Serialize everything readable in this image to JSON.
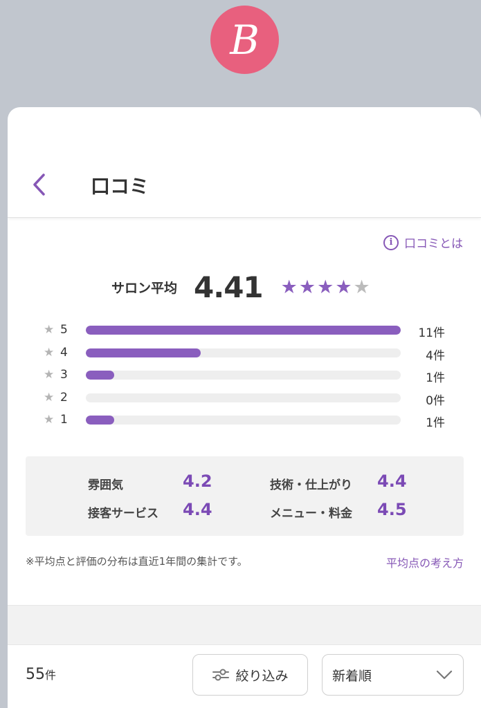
{
  "logo": {
    "letter": "B",
    "color": "#e8607e"
  },
  "header": {
    "title": "口コミ",
    "back_icon": "chevron-left-icon"
  },
  "about_link": {
    "label": "口コミとは",
    "icon": "info-icon"
  },
  "summary": {
    "label": "サロン平均",
    "value": "4.41",
    "stars_filled": 4,
    "stars_total": 5
  },
  "distribution": [
    {
      "stars": "5",
      "count": "11件",
      "fraction": 1.0
    },
    {
      "stars": "4",
      "count": "4件",
      "fraction": 0.364
    },
    {
      "stars": "3",
      "count": "1件",
      "fraction": 0.091
    },
    {
      "stars": "2",
      "count": "0件",
      "fraction": 0.0
    },
    {
      "stars": "1",
      "count": "1件",
      "fraction": 0.091
    }
  ],
  "categories": [
    {
      "label": "雰囲気",
      "value": "4.2"
    },
    {
      "label": "技術・仕上がり",
      "value": "4.4"
    },
    {
      "label": "接客サービス",
      "value": "4.4"
    },
    {
      "label": "メニュー・料金",
      "value": "4.5"
    }
  ],
  "note": "※平均点と評価の分布は直近1年間の集計です。",
  "method_link": "平均点の考え方",
  "list": {
    "count_number": "55",
    "count_unit": "件",
    "filter_label": "絞り込み",
    "filter_icon": "sliders-icon",
    "sort_label": "新着順",
    "sort_icon": "chevron-down-icon"
  },
  "colors": {
    "accent": "#8a5ebe",
    "link": "#8657b6",
    "background": "#c1c6ce"
  }
}
